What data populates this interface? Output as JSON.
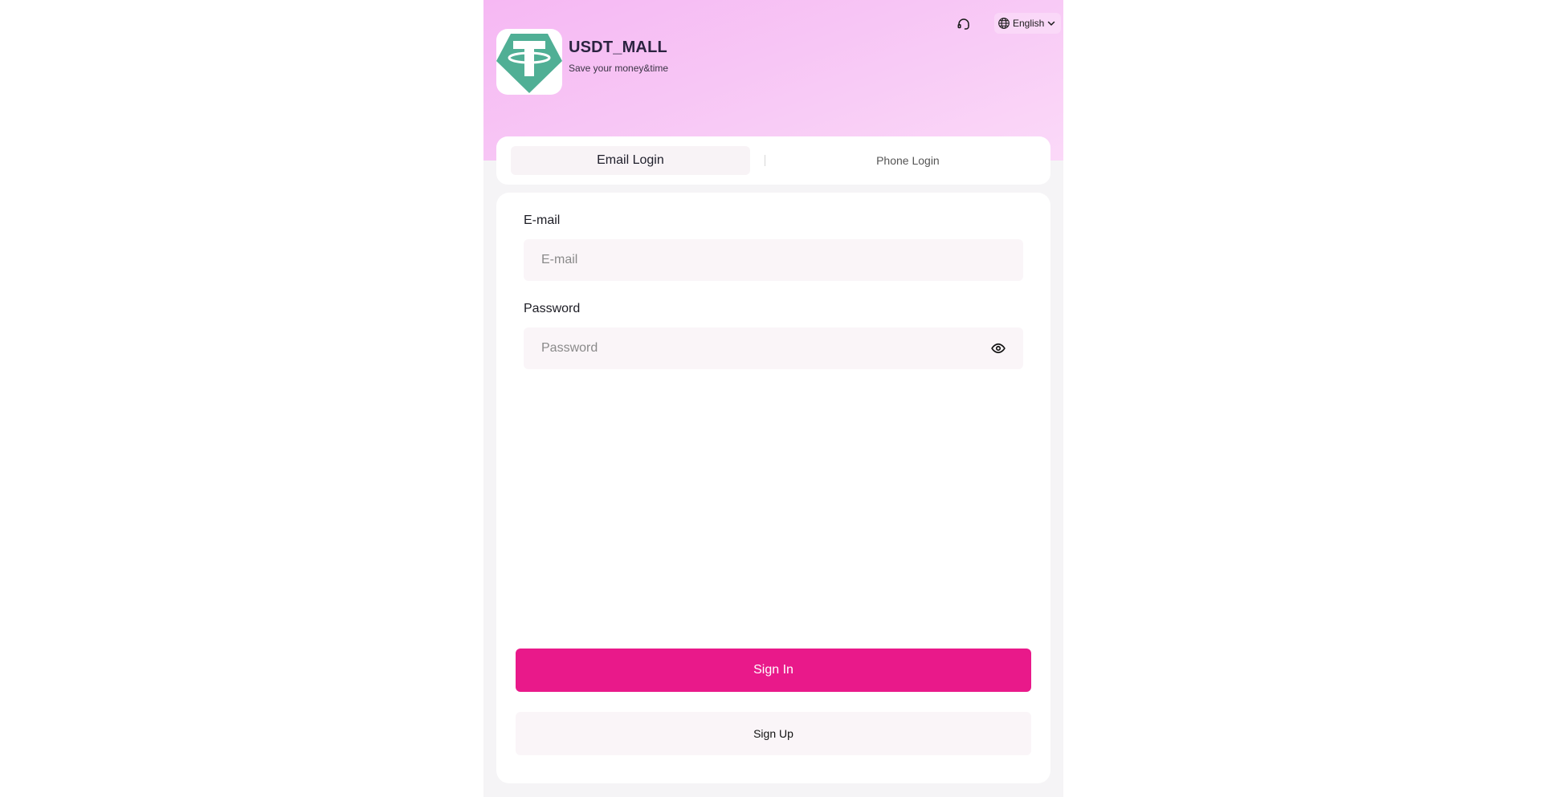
{
  "header": {
    "brand_name": "USDT_MALL",
    "slogan": "Save your money&time",
    "language": "English",
    "icons": {
      "support": "headset-icon",
      "language": "globe-icon",
      "dropdown": "chevron-down-icon",
      "logo": "tether-logo-icon"
    }
  },
  "tabs": [
    {
      "label": "Email Login",
      "active": true
    },
    {
      "label": "Phone Login",
      "active": false
    }
  ],
  "form": {
    "email": {
      "label": "E-mail",
      "placeholder": "E-mail",
      "value": ""
    },
    "password": {
      "label": "Password",
      "placeholder": "Password",
      "value": "",
      "toggle_icon": "eye-icon"
    }
  },
  "actions": {
    "sign_in": "Sign In",
    "sign_up": "Sign Up"
  },
  "colors": {
    "accent": "#e9198a",
    "logo_green": "#50af95",
    "hero_pink": "#f6b8f3"
  }
}
